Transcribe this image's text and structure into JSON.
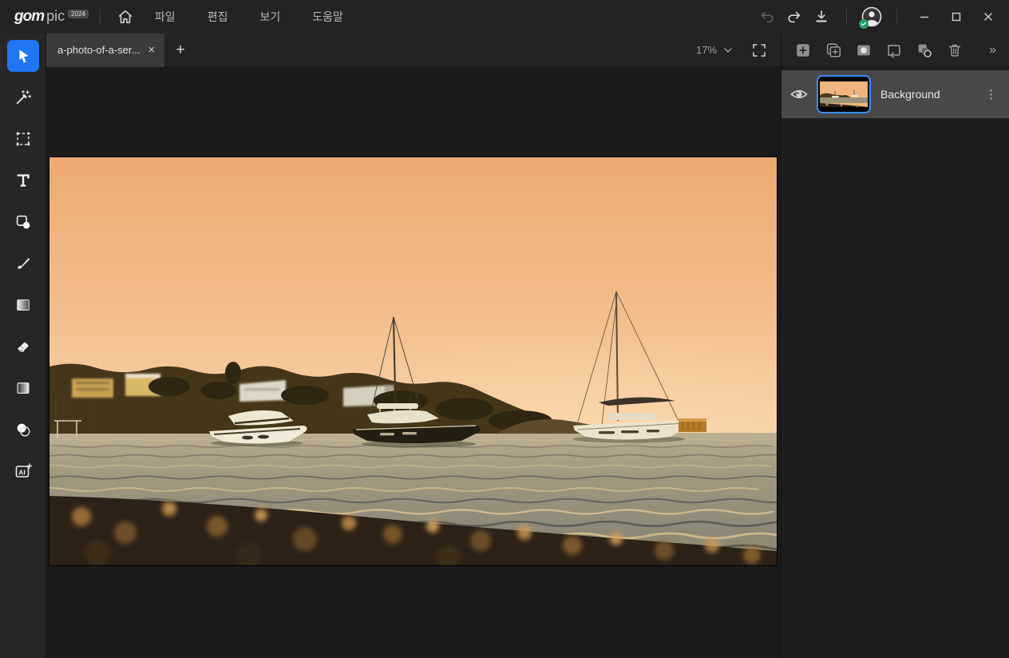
{
  "logo": {
    "gom": "gom",
    "pic": "pic",
    "badge": "2024"
  },
  "menubar": {
    "items": [
      "파일",
      "편집",
      "보기",
      "도움말"
    ]
  },
  "tabs": {
    "active_title": "a-photo-of-a-ser...",
    "close_glyph": "×",
    "new_tab_glyph": "+"
  },
  "viewport": {
    "zoom_level": "17%"
  },
  "layers_panel": {
    "items": [
      {
        "name": "Background",
        "visible": true,
        "selected": true
      }
    ],
    "menu_glyph": "⋮",
    "collapse_glyph": "»"
  },
  "canvas_image": {
    "scene": "sunset harbor with three yachts, shoreline buildings and pebble beach"
  },
  "colors": {
    "accent_blue": "#2176f3",
    "selection_border": "#3d8df5",
    "online_badge_green": "#21a366",
    "sky_top": "#ecaa72",
    "sky_horizon": "#f8d3a9",
    "water": "#9a9179",
    "beach_dark": "#2c2117",
    "panel_dark": "#1e1e1e",
    "layer_row": "#484848"
  }
}
